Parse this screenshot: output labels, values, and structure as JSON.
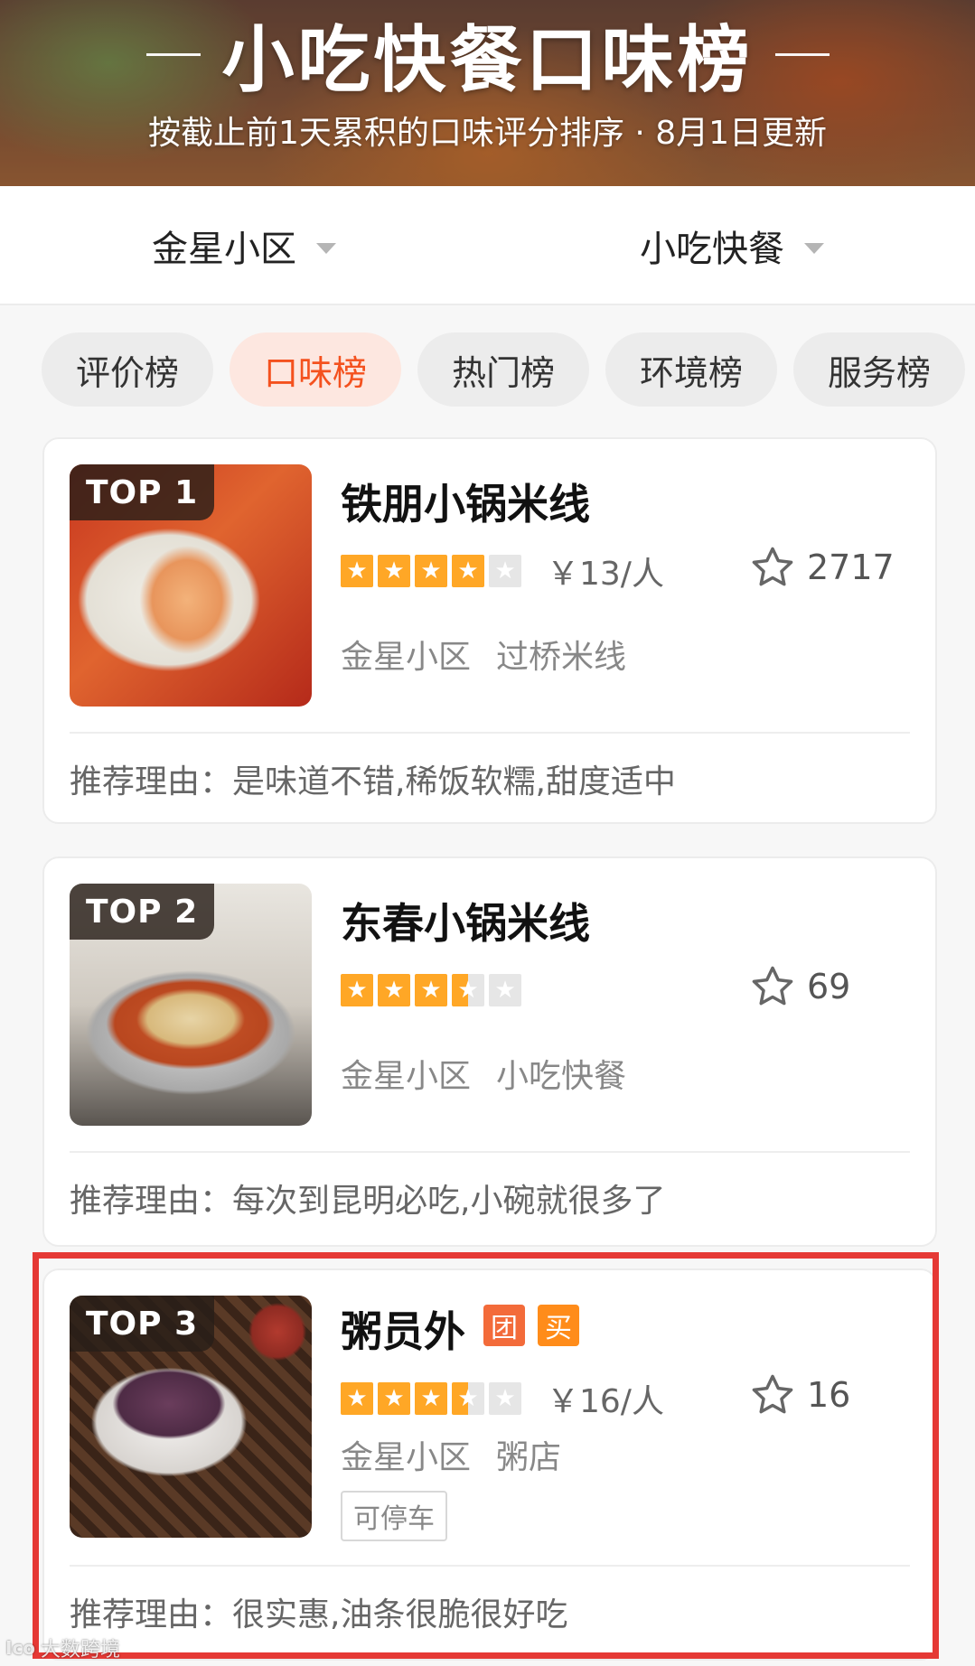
{
  "banner": {
    "title": "小吃快餐口味榜",
    "subtitle": "按截止前1天累积的口味评分排序 · 8月1日更新"
  },
  "filters": {
    "area": "金星小区",
    "category": "小吃快餐"
  },
  "tabs": [
    {
      "label": "评价榜",
      "active": false
    },
    {
      "label": "口味榜",
      "active": true
    },
    {
      "label": "热门榜",
      "active": false
    },
    {
      "label": "环境榜",
      "active": false
    },
    {
      "label": "服务榜",
      "active": false
    }
  ],
  "shops": [
    {
      "rank": "TOP 1",
      "name": "铁朋小锅米线",
      "rating": 4,
      "price": "￥13/人",
      "favorites": "2717",
      "area": "金星小区",
      "category": "过桥米线",
      "reason": "推荐理由：是味道不错,稀饭软糯,甜度适中"
    },
    {
      "rank": "TOP 2",
      "name": "东春小锅米线",
      "rating": 3.5,
      "price": "",
      "favorites": "69",
      "area": "金星小区",
      "category": "小吃快餐",
      "reason": "推荐理由：每次到昆明必吃,小碗就很多了"
    },
    {
      "rank": "TOP 3",
      "name": "粥员外",
      "badge_tuan": "团",
      "badge_mai": "买",
      "rating": 3.5,
      "price": "￥16/人",
      "favorites": "16",
      "area": "金星小区",
      "category": "粥店",
      "feature": "可停车",
      "reason": "推荐理由：很实惠,油条很脆很好吃"
    }
  ],
  "watermark": {
    "logo": "Ico",
    "text": "大数跨境"
  },
  "colors": {
    "accent": "#f4511e",
    "star": "#ffa726",
    "highlight": "#e53935"
  }
}
